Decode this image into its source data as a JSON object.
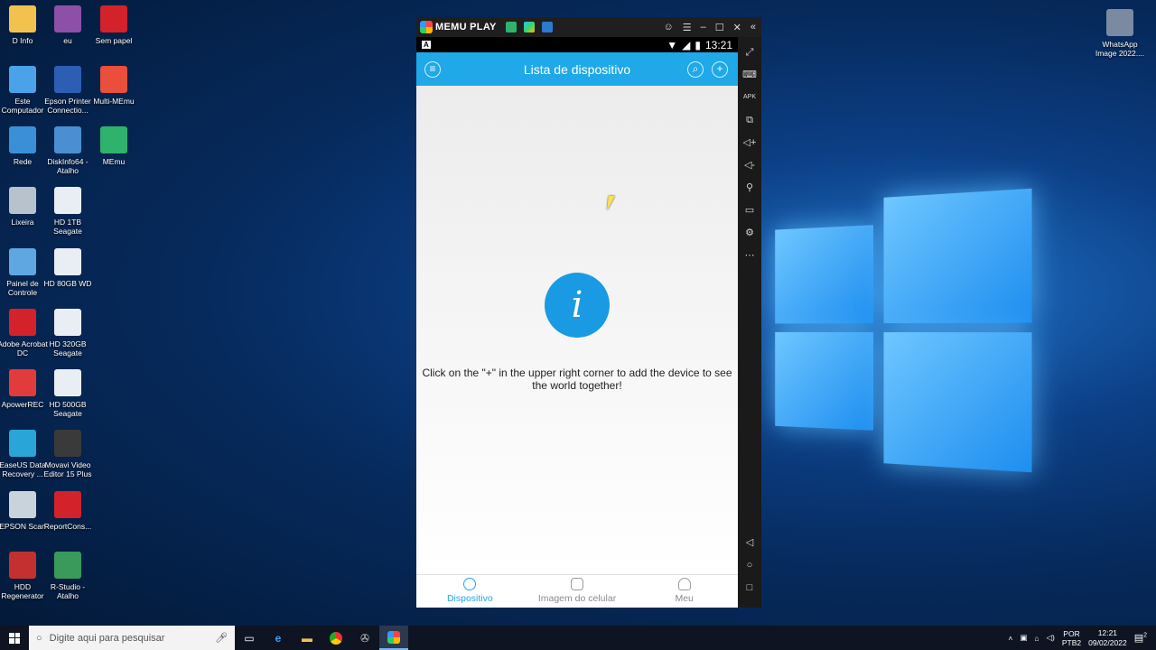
{
  "desktop": {
    "icons_col1": [
      {
        "label": "D Info",
        "icon": "folder-user-icon",
        "color": "#f2c14e"
      },
      {
        "label": "Este Computador",
        "icon": "computer-icon",
        "color": "#4aa3e8"
      },
      {
        "label": "Rede",
        "icon": "network-icon",
        "color": "#3b8fd6"
      },
      {
        "label": "Lixeira",
        "icon": "recycle-bin-icon",
        "color": "#b8c2cc"
      },
      {
        "label": "Painel de Controle",
        "icon": "control-panel-icon",
        "color": "#5fa7e0"
      },
      {
        "label": "Adobe Acrobat DC",
        "icon": "acrobat-icon",
        "color": "#d3222a"
      },
      {
        "label": "ApowerREC",
        "icon": "apowerrec-icon",
        "color": "#e23b3b"
      },
      {
        "label": "EaseUS Data Recovery ...",
        "icon": "easeus-icon",
        "color": "#2aa5d8"
      },
      {
        "label": "EPSON Scan",
        "icon": "scanner-icon",
        "color": "#c9d3dc"
      },
      {
        "label": "HDD Regenerator",
        "icon": "hdd-regenerator-icon",
        "color": "#c23030"
      }
    ],
    "icons_col2": [
      {
        "label": "eu",
        "icon": "winrar-icon",
        "color": "#8e4fa8"
      },
      {
        "label": "Epson Printer Connectio...",
        "icon": "epson-printer-icon",
        "color": "#2c5fb3"
      },
      {
        "label": "DiskInfo64 - Atalho",
        "icon": "diskinfo-icon",
        "color": "#4a8fd1"
      },
      {
        "label": "HD 1TB Seagate",
        "icon": "drive-icon",
        "color": "#e8eef3"
      },
      {
        "label": "HD 80GB WD",
        "icon": "drive-icon",
        "color": "#e8eef3"
      },
      {
        "label": "HD 320GB Seagate",
        "icon": "drive-icon",
        "color": "#e8eef3"
      },
      {
        "label": "HD 500GB Seagate",
        "icon": "drive-icon",
        "color": "#e8eef3"
      },
      {
        "label": "Movavi Video Editor 15 Plus",
        "icon": "movavi-icon",
        "color": "#3a3a3a"
      },
      {
        "label": "ReportCons...",
        "icon": "pdf-icon",
        "color": "#d3222a"
      },
      {
        "label": "R-Studio - Atalho",
        "icon": "rstudio-icon",
        "color": "#3a9a5c"
      }
    ],
    "icons_col3": [
      {
        "label": "Sem papel",
        "icon": "pdf-icon",
        "color": "#d3222a"
      },
      {
        "label": "Multi-MEmu",
        "icon": "memu-multi-icon",
        "color": "#e94f3c"
      },
      {
        "label": "MEmu",
        "icon": "memu-icon",
        "color": "#2fb36c"
      }
    ],
    "icons_right": [
      {
        "label": "WhatsApp Image 2022....",
        "icon": "image-file-icon",
        "color": "#7a8aa0"
      }
    ]
  },
  "emulator": {
    "brand": "MEMU PLAY",
    "sidebar_tools": [
      "fullscreen-icon",
      "keyboard-icon",
      "apk-icon",
      "multi-window-icon",
      "volume-up-icon",
      "volume-down-icon",
      "location-icon",
      "folder-icon",
      "settings-icon",
      "more-icon"
    ],
    "nav_buttons": [
      "back-icon",
      "home-icon",
      "recent-apps-icon"
    ]
  },
  "phone": {
    "status_left": "A",
    "time": "13:21",
    "title": "Lista de dispositivo",
    "empty_message": "Click on the \"+\" in the upper right corner to add the device to see the world together!",
    "tabs": [
      {
        "label": "Dispositivo",
        "active": true
      },
      {
        "label": "Imagem do celular",
        "active": false
      },
      {
        "label": "Meu",
        "active": false
      }
    ],
    "accent": "#1fa9e8"
  },
  "taskbar": {
    "search_placeholder": "Digite aqui para pesquisar",
    "language_line1": "POR",
    "language_line2": "PTB2",
    "time": "12:21",
    "date": "09/02/2022",
    "notification_count": "2"
  }
}
